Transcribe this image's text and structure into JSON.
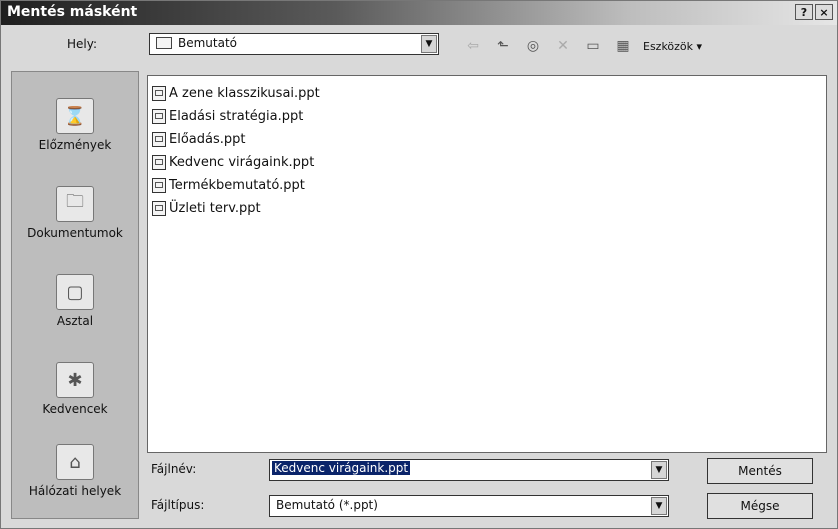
{
  "window": {
    "title": "Mentés másként",
    "help": "?",
    "close": "×"
  },
  "toolbar": {
    "location_label": "Hely:",
    "location_value": "Bemutató",
    "tools_label": "Eszközök"
  },
  "places": [
    {
      "label": "Előzmények",
      "icon": "history-icon"
    },
    {
      "label": "Dokumentumok",
      "icon": "documents-icon"
    },
    {
      "label": "Asztal",
      "icon": "desktop-icon"
    },
    {
      "label": "Kedvencek",
      "icon": "favorites-icon"
    },
    {
      "label": "Hálózati helyek",
      "icon": "network-icon"
    }
  ],
  "files": [
    "A zene klasszikusai.ppt",
    "Eladási stratégia.ppt",
    "Előadás.ppt",
    "Kedvenc virágaink.ppt",
    "Termékbemutató.ppt",
    "Üzleti terv.ppt"
  ],
  "form": {
    "filename_label": "Fájlnév:",
    "filename_value": "Kedvenc virágaink.ppt",
    "filetype_label": "Fájltípus:",
    "filetype_value": "Bemutató (*.ppt)",
    "save_label": "Mentés",
    "cancel_label": "Mégse"
  }
}
